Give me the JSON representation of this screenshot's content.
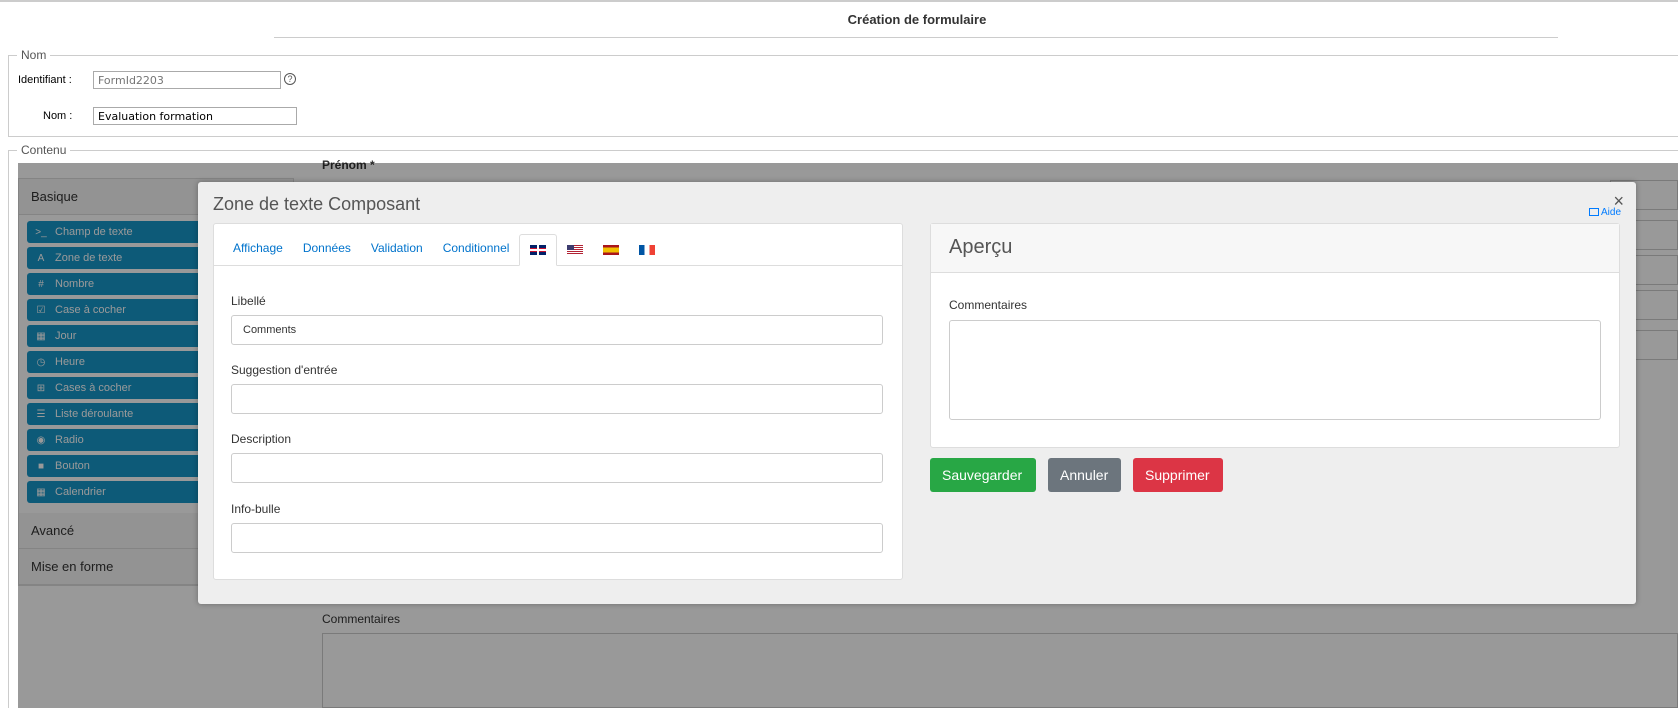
{
  "page": {
    "title": "Création de formulaire"
  },
  "nom_section": {
    "legend": "Nom",
    "identifiant_label": "Identifiant :",
    "identifiant_placeholder": "FormId2203",
    "nom_label": "Nom :",
    "nom_value": "Evaluation formation"
  },
  "contenu_section": {
    "legend": "Contenu"
  },
  "sidebar": {
    "groups": [
      "Basique",
      "Avancé",
      "Mise en forme"
    ],
    "components": [
      {
        "icon": ">_",
        "label": "Champ de texte"
      },
      {
        "icon": "A",
        "label": "Zone de texte"
      },
      {
        "icon": "#",
        "label": "Nombre"
      },
      {
        "icon": "☑",
        "label": "Case à cocher"
      },
      {
        "icon": "▦",
        "label": "Jour"
      },
      {
        "icon": "◷",
        "label": "Heure"
      },
      {
        "icon": "⊞",
        "label": "Cases à cocher"
      },
      {
        "icon": "☰",
        "label": "Liste déroulante"
      },
      {
        "icon": "◉",
        "label": "Radio"
      },
      {
        "icon": "■",
        "label": "Bouton"
      },
      {
        "icon": "▦",
        "label": "Calendrier"
      }
    ]
  },
  "background_form": {
    "field1_label": "Prénom *",
    "field2_label": "Commentaires"
  },
  "modal": {
    "title": "Zone de texte Composant",
    "aide": "Aide",
    "close": "×",
    "tabs": [
      "Affichage",
      "Données",
      "Validation",
      "Conditionnel"
    ],
    "flags": [
      "gb-flag-icon",
      "us-flag-icon",
      "es-flag-icon",
      "fr-flag-icon"
    ],
    "fields": {
      "libelle_label": "Libellé",
      "libelle_value": "Comments",
      "suggestion_label": "Suggestion d'entrée",
      "suggestion_value": "",
      "description_label": "Description",
      "description_value": "",
      "infobulle_label": "Info-bulle",
      "infobulle_value": ""
    },
    "preview": {
      "title": "Aperçu",
      "field_label": "Commentaires"
    },
    "buttons": {
      "save": "Sauvegarder",
      "cancel": "Annuler",
      "delete": "Supprimer"
    }
  }
}
